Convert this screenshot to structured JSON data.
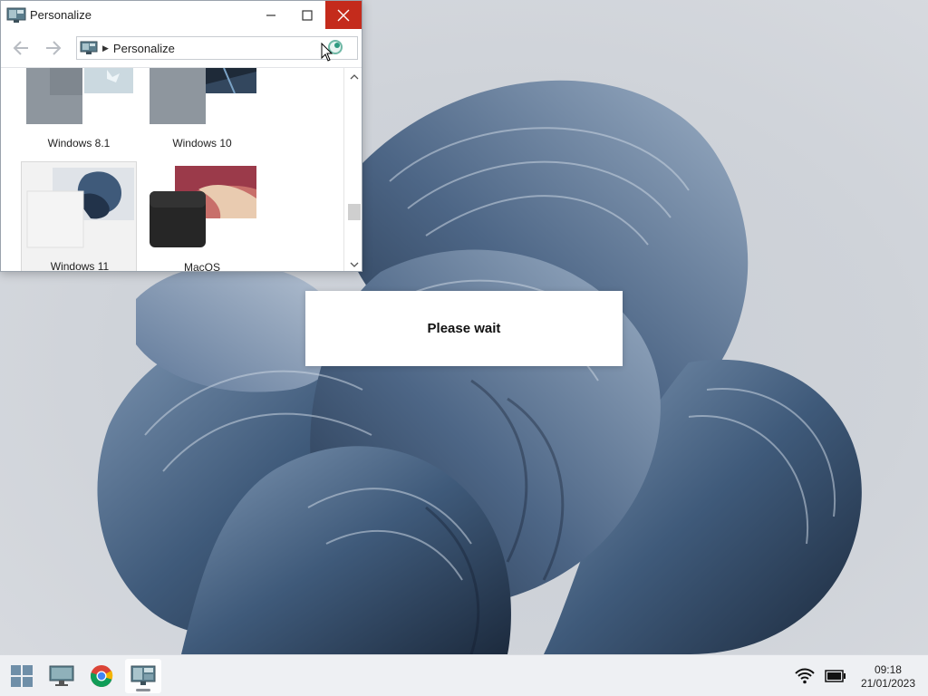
{
  "window": {
    "title": "Personalize",
    "address": "Personalize"
  },
  "themes": [
    {
      "label": "Windows 8.1",
      "selected": false
    },
    {
      "label": "Windows 10",
      "selected": false
    },
    {
      "label": "Windows 11",
      "selected": true
    },
    {
      "label": "MacOS",
      "selected": false
    }
  ],
  "dialog": {
    "message": "Please wait"
  },
  "taskbar": {
    "items": [
      "start-icon",
      "this-pc-icon",
      "chrome-icon",
      "personalize-icon"
    ],
    "active": "personalize-icon"
  },
  "tray": {
    "time": "09:18",
    "date": "21/01/2023",
    "icons": [
      "wifi-icon",
      "battery-icon"
    ]
  },
  "colors": {
    "close_button": "#c42b1c",
    "accent": "#3f5a7a"
  }
}
